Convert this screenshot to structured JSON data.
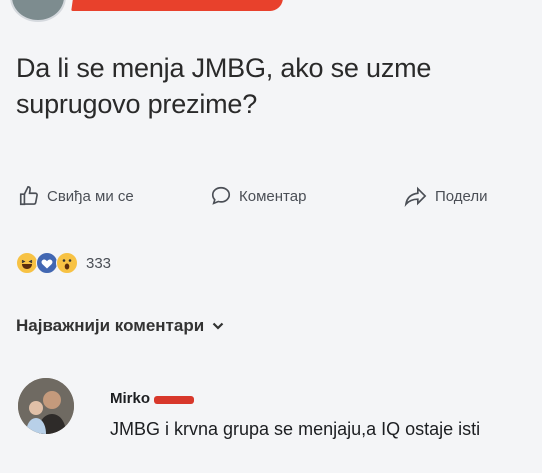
{
  "post": {
    "text": "Da li se menja JMBG, ako se uzme suprugovo prezime?"
  },
  "actions": {
    "like_label": "Свиђа ми се",
    "comment_label": "Коментар",
    "share_label": "Подели"
  },
  "reactions": {
    "types": [
      "haha",
      "love",
      "wow"
    ],
    "count": "333"
  },
  "comments_filter": {
    "label": "Најважнији коментари"
  },
  "comment": {
    "author": "Mirko",
    "text": "JMBG i krvna grupa se menjaju,a IQ ostaje isti"
  },
  "colors": {
    "redaction": "#e8412c",
    "text": "#1c1e21",
    "secondary_text": "#4b4f56"
  },
  "icons": [
    "thumbs-up-icon",
    "comment-bubble-icon",
    "share-arrow-icon",
    "chevron-down-icon"
  ]
}
